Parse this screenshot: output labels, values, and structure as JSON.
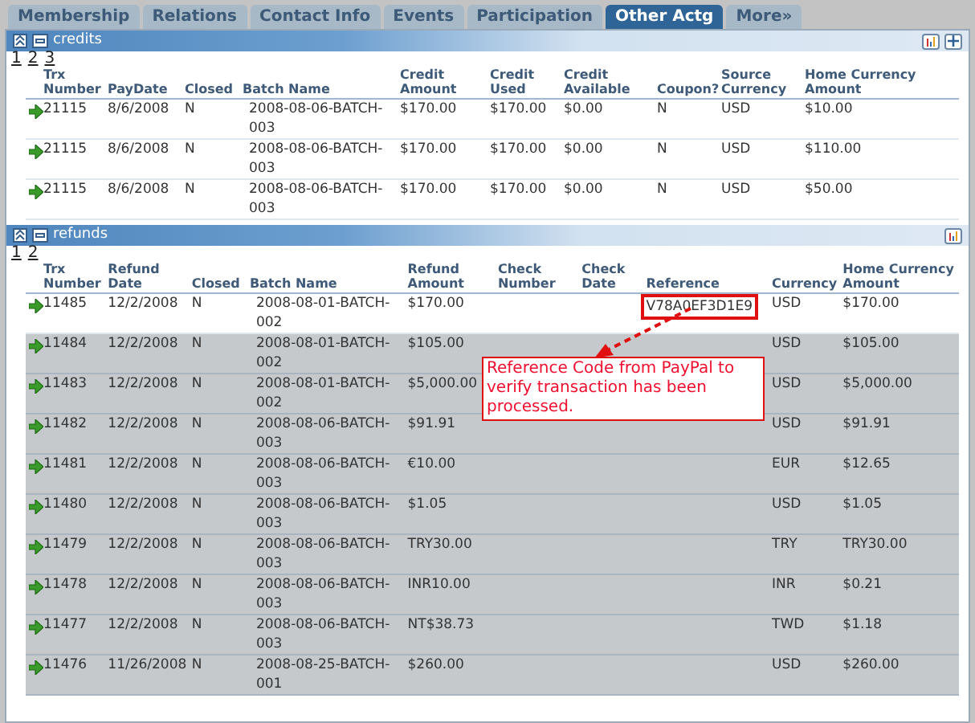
{
  "tabs": [
    {
      "label": "Membership",
      "selected": false
    },
    {
      "label": "Relations",
      "selected": false
    },
    {
      "label": "Contact Info",
      "selected": false
    },
    {
      "label": "Events",
      "selected": false
    },
    {
      "label": "Participation",
      "selected": false
    },
    {
      "label": "Other Actg",
      "selected": true
    },
    {
      "label": "More»",
      "selected": false
    }
  ],
  "credits": {
    "title": "credits",
    "pages": [
      "1",
      "2",
      "3"
    ],
    "columns": [
      "Trx Number",
      "PayDate",
      "Closed",
      "Batch Name",
      "Credit Amount",
      "Credit Used",
      "Credit Available",
      "Coupon?",
      "Source Currency",
      "Home Currency Amount"
    ],
    "rows": [
      {
        "dimmed": false,
        "cells": [
          "21115",
          "8/6/2008",
          "N",
          "2008-08-06-BATCH-003",
          "$170.00",
          "$170.00",
          "$0.00",
          "N",
          "USD",
          "$10.00"
        ]
      },
      {
        "dimmed": false,
        "cells": [
          "21115",
          "8/6/2008",
          "N",
          "2008-08-06-BATCH-003",
          "$170.00",
          "$170.00",
          "$0.00",
          "N",
          "USD",
          "$110.00"
        ]
      },
      {
        "dimmed": false,
        "cells": [
          "21115",
          "8/6/2008",
          "N",
          "2008-08-06-BATCH-003",
          "$170.00",
          "$170.00",
          "$0.00",
          "N",
          "USD",
          "$50.00"
        ]
      }
    ]
  },
  "refunds": {
    "title": "refunds",
    "pages": [
      "1",
      "2"
    ],
    "columns": [
      "Trx Number",
      "Refund Date",
      "Closed",
      "Batch Name",
      "Refund Amount",
      "Check Number",
      "Check Date",
      "Reference",
      "Currency",
      "Home Currency Amount"
    ],
    "rows": [
      {
        "dimmed": false,
        "cells": [
          "11485",
          "12/2/2008",
          "N",
          "2008-08-01-BATCH-002",
          "$170.00",
          "",
          "",
          "V78A0EF3D1E9",
          "USD",
          "$170.00"
        ],
        "reference_marked": true
      },
      {
        "dimmed": true,
        "cells": [
          "11484",
          "12/2/2008",
          "N",
          "2008-08-01-BATCH-002",
          "$105.00",
          "",
          "",
          "",
          "USD",
          "$105.00"
        ],
        "reference_marked": false
      },
      {
        "dimmed": true,
        "cells": [
          "11483",
          "12/2/2008",
          "N",
          "2008-08-01-BATCH-002",
          "$5,000.00",
          "",
          "",
          "",
          "USD",
          "$5,000.00"
        ],
        "reference_marked": false
      },
      {
        "dimmed": true,
        "cells": [
          "11482",
          "12/2/2008",
          "N",
          "2008-08-06-BATCH-003",
          "$91.91",
          "",
          "",
          "",
          "USD",
          "$91.91"
        ],
        "reference_marked": false
      },
      {
        "dimmed": true,
        "cells": [
          "11481",
          "12/2/2008",
          "N",
          "2008-08-06-BATCH-003",
          "€10.00",
          "",
          "",
          "",
          "EUR",
          "$12.65"
        ],
        "reference_marked": false
      },
      {
        "dimmed": true,
        "cells": [
          "11480",
          "12/2/2008",
          "N",
          "2008-08-06-BATCH-003",
          "$1.05",
          "",
          "",
          "",
          "USD",
          "$1.05"
        ],
        "reference_marked": false
      },
      {
        "dimmed": true,
        "cells": [
          "11479",
          "12/2/2008",
          "N",
          "2008-08-06-BATCH-003",
          "TRY30.00",
          "",
          "",
          "",
          "TRY",
          "TRY30.00"
        ],
        "reference_marked": false
      },
      {
        "dimmed": true,
        "cells": [
          "11478",
          "12/2/2008",
          "N",
          "2008-08-06-BATCH-003",
          "INR10.00",
          "",
          "",
          "",
          "INR",
          "$0.21"
        ],
        "reference_marked": false
      },
      {
        "dimmed": true,
        "cells": [
          "11477",
          "12/2/2008",
          "N",
          "2008-08-06-BATCH-003",
          "NT$38.73",
          "",
          "",
          "",
          "TWD",
          "$1.18"
        ],
        "reference_marked": false
      },
      {
        "dimmed": true,
        "cells": [
          "11476",
          "11/26/2008",
          "N",
          "2008-08-25-BATCH-001",
          "$260.00",
          "",
          "",
          "",
          "USD",
          "$260.00"
        ],
        "reference_marked": false
      }
    ]
  },
  "callout": {
    "text": "Reference Code from PayPal to verify transaction has been processed."
  }
}
